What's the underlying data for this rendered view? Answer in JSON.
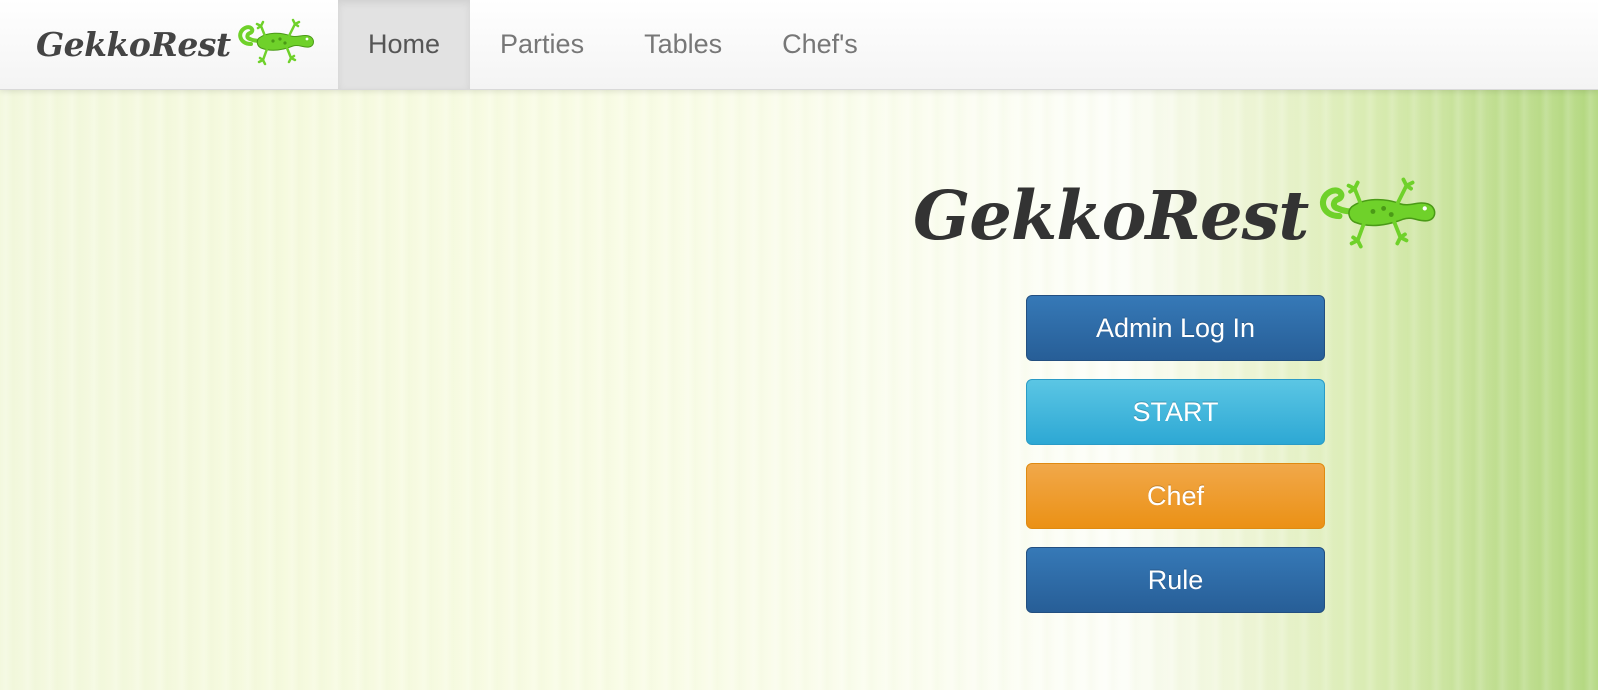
{
  "navbar": {
    "brand": {
      "logo_text": "GekkoRest",
      "icon": "gecko-icon"
    },
    "items": [
      {
        "label": "Home",
        "active": true
      },
      {
        "label": "Parties",
        "active": false
      },
      {
        "label": "Tables",
        "active": false
      },
      {
        "label": "Chef's",
        "active": false
      }
    ]
  },
  "hero": {
    "logo_text": "GekkoRest",
    "icon": "gecko-icon"
  },
  "buttons": {
    "admin_login": "Admin Log In",
    "start": "START",
    "chef": "Chef",
    "rule": "Rule"
  },
  "colors": {
    "primary": "#2b6aa6",
    "info": "#3fb5dc",
    "warning": "#ee9a2c",
    "gecko": "#6fd12a"
  }
}
